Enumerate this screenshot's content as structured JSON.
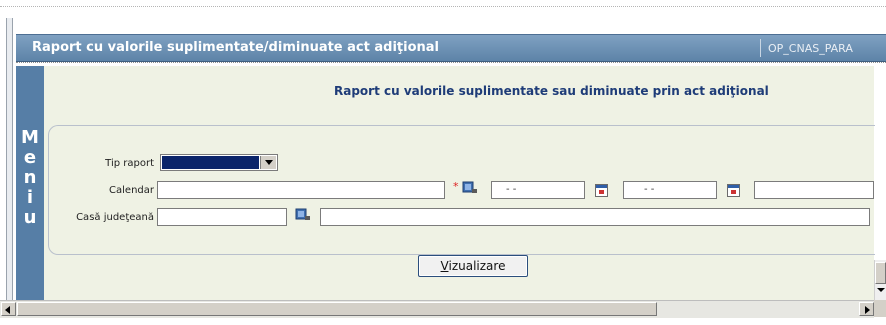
{
  "window": {
    "title": "Raport cu valorile suplimentate/diminuate act adiţional",
    "code": "OP_CNAS_PARA"
  },
  "menu": {
    "letters": [
      "M",
      "e",
      "n",
      "i",
      "u"
    ]
  },
  "report": {
    "heading": "Raport cu valorile suplimentate sau diminuate prin act adiţional"
  },
  "form": {
    "tip_raport": {
      "label": "Tip raport"
    },
    "calendar": {
      "label": "Calendar",
      "required_mark": "*",
      "date_from": "-  -",
      "date_to": "-  -"
    },
    "casa": {
      "label": "Casă judeţeană"
    }
  },
  "actions": {
    "vizualizare_hotkey": "V",
    "vizualizare_rest": "izualizare"
  },
  "icons": {
    "lookup": "book-lookup-icon",
    "calendar": "calendar-icon"
  },
  "colors": {
    "title_bar": "#6a8fb3",
    "menu_bar": "#567ea6",
    "content_bg": "#eff2e4",
    "heading_text": "#1e3c78",
    "select_fill": "#0a246a"
  }
}
